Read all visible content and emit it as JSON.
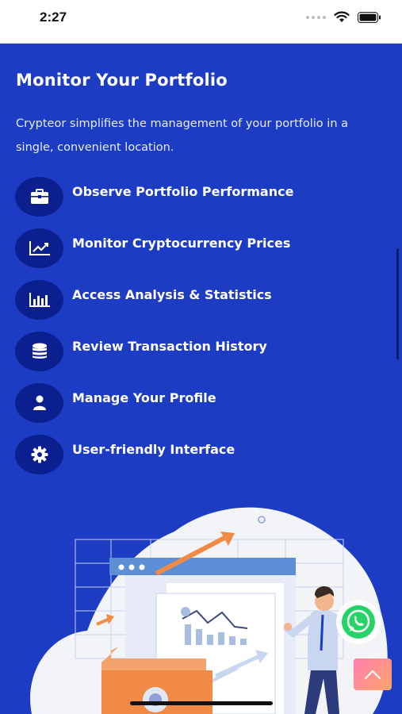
{
  "status_bar": {
    "time": "2:27",
    "icons": [
      "signal-dots-icon",
      "wifi-icon",
      "battery-icon"
    ]
  },
  "section": {
    "title": "Monitor Your Portfolio",
    "description": "Crypteor simplifies the management of your portfolio in a single, convenient location."
  },
  "features": [
    {
      "label": "Observe Portfolio Performance",
      "icon": "briefcase-icon"
    },
    {
      "label": "Monitor Cryptocurrency Prices",
      "icon": "line-chart-icon"
    },
    {
      "label": "Access Analysis & Statistics",
      "icon": "bar-chart-icon"
    },
    {
      "label": "Review Transaction History",
      "icon": "database-icon"
    },
    {
      "label": "Manage Your Profile",
      "icon": "user-icon"
    },
    {
      "label": "User-friendly Interface",
      "icon": "gear-icon"
    }
  ],
  "colors": {
    "background": "#1c3cc4",
    "icon_circle": "#0b1f8f",
    "accent_orange": "#f08a45",
    "whatsapp_green": "#25d366"
  }
}
